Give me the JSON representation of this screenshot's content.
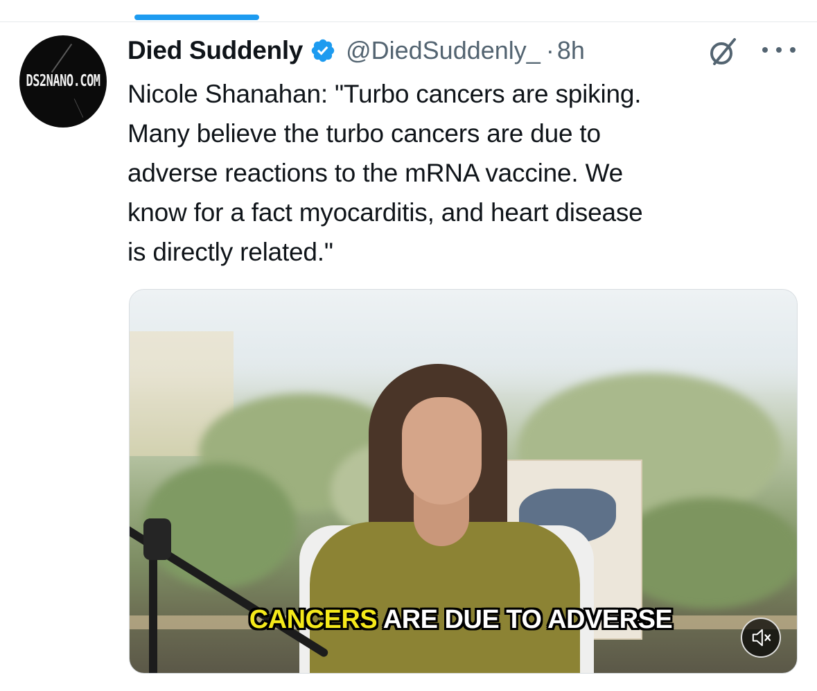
{
  "author": {
    "display_name": "Died Suddenly",
    "handle": "@DiedSuddenly_",
    "separator": "·",
    "time": "8h",
    "avatar_text": "DS2NANO.COM",
    "verified": true
  },
  "tweet": {
    "lines": [
      "Nicole Shanahan: \"Turbo cancers are spiking.",
      "Many believe the turbo cancers are due to",
      "adverse reactions to the mRNA vaccine. We",
      "know for a fact myocarditis, and heart disease",
      "is directly related.\""
    ]
  },
  "media": {
    "caption_highlight": "CANCERS",
    "caption_rest": " ARE DUE TO ADVERSE",
    "muted": true
  },
  "icons": {
    "verified": "verified-badge-icon",
    "grok": "grok-icon",
    "more": "more-options-icon",
    "mute": "volume-muted-icon"
  },
  "colors": {
    "accent": "#1d9bf0",
    "secondary_text": "#536471",
    "primary_text": "#0f1419",
    "caption_highlight": "#f5e91a"
  }
}
